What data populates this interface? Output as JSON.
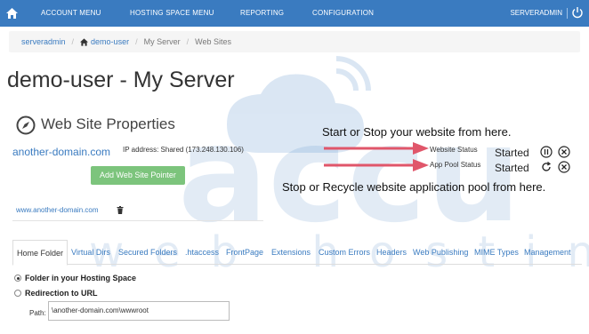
{
  "nav": {
    "items": [
      "ACCOUNT MENU",
      "HOSTING SPACE MENU",
      "REPORTING",
      "CONFIGURATION"
    ],
    "user": "SERVERADMIN",
    "bar_color": "#3a7bc0",
    "home_icon": "home-icon",
    "power_icon": "power-icon"
  },
  "breadcrumb": {
    "items": [
      "serveradmin",
      "demo-user",
      "My Server",
      "Web Sites"
    ]
  },
  "page_title": "demo-user - My Server",
  "properties": {
    "title": "Web Site Properties",
    "icon": "compass-icon",
    "site_name": "another-domain.com",
    "ip_address": "IP address: Shared (173.248.130.106)",
    "add_pointer_label": "Add Web Site Pointer",
    "pointer_link": "www.another-domain.com"
  },
  "status": {
    "website_label": "Website Status",
    "website_value": "Started",
    "app_pool_label": "App Pool Status",
    "app_pool_value": "Started"
  },
  "annotations": {
    "start_stop": "Start or Stop your website from here.",
    "recycle": "Stop or Recycle website application pool from here.",
    "arrow_color": "#e0566a"
  },
  "tabs": [
    "Home Folder",
    "Virtual Dirs",
    "Secured Folders",
    ".htaccess",
    "FrontPage",
    "Extensions",
    "Custom Errors",
    "Headers",
    "Web Publishing",
    "MIME Types",
    "Management"
  ],
  "home_folder": {
    "option_1": "Folder in your Hosting Space",
    "option_2": "Redirection to URL",
    "path_label": "Path:",
    "path_value": "\\another-domain.com\\wwwroot"
  },
  "watermark": {
    "brand": "accu",
    "tagline": "web hosting"
  }
}
